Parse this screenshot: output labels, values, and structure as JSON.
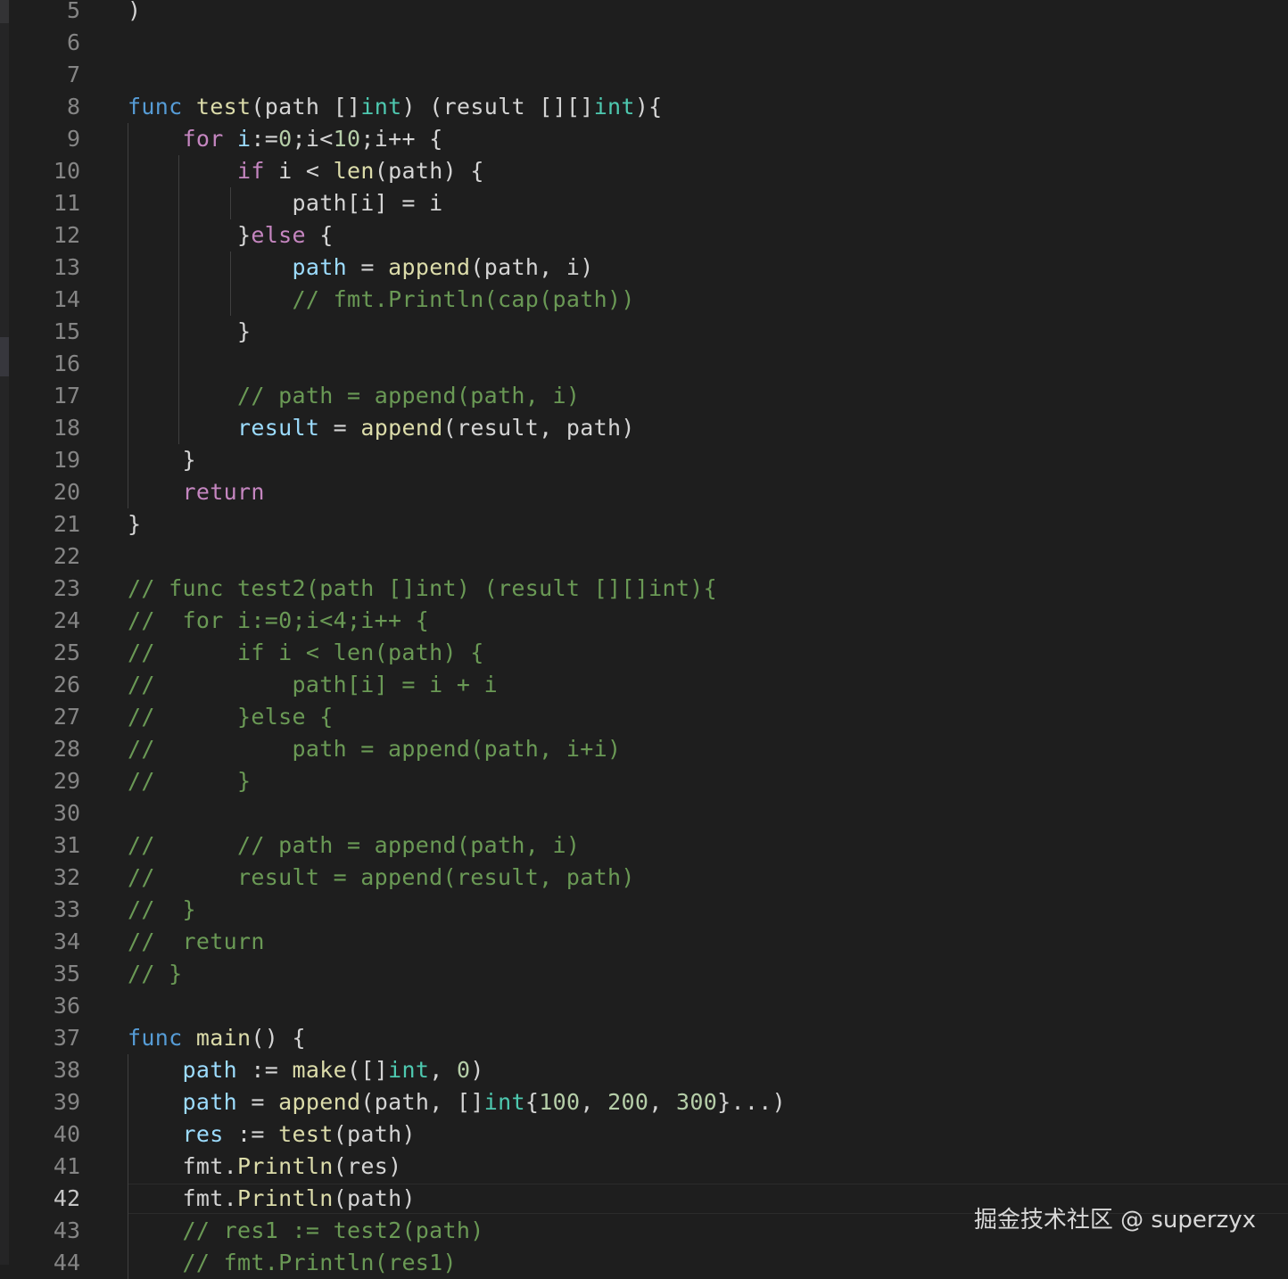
{
  "editor": {
    "current_line": 42,
    "lines": [
      {
        "n": "5",
        "tokens": [
          {
            "t": ")",
            "c": "txt"
          }
        ]
      },
      {
        "n": "6",
        "tokens": []
      },
      {
        "n": "7",
        "tokens": []
      },
      {
        "n": "8",
        "tokens": [
          {
            "t": "func",
            "c": "kw"
          },
          {
            "t": " ",
            "c": "txt"
          },
          {
            "t": "test",
            "c": "fn"
          },
          {
            "t": "(path []",
            "c": "txt"
          },
          {
            "t": "int",
            "c": "type"
          },
          {
            "t": ") (result [][]",
            "c": "txt"
          },
          {
            "t": "int",
            "c": "type"
          },
          {
            "t": "){",
            "c": "txt"
          }
        ]
      },
      {
        "n": "9",
        "tokens": [
          {
            "t": "    ",
            "c": "txt"
          },
          {
            "t": "for",
            "c": "ctl"
          },
          {
            "t": " ",
            "c": "txt"
          },
          {
            "t": "i",
            "c": "var"
          },
          {
            "t": ":=",
            "c": "txt"
          },
          {
            "t": "0",
            "c": "num"
          },
          {
            "t": ";i<",
            "c": "txt"
          },
          {
            "t": "10",
            "c": "num"
          },
          {
            "t": ";i++ {",
            "c": "txt"
          }
        ]
      },
      {
        "n": "10",
        "tokens": [
          {
            "t": "        ",
            "c": "txt"
          },
          {
            "t": "if",
            "c": "ctl"
          },
          {
            "t": " i < ",
            "c": "txt"
          },
          {
            "t": "len",
            "c": "fn"
          },
          {
            "t": "(path) {",
            "c": "txt"
          }
        ]
      },
      {
        "n": "11",
        "tokens": [
          {
            "t": "            path[i] = i",
            "c": "txt"
          }
        ]
      },
      {
        "n": "12",
        "tokens": [
          {
            "t": "        }",
            "c": "txt"
          },
          {
            "t": "else",
            "c": "ctl"
          },
          {
            "t": " {",
            "c": "txt"
          }
        ]
      },
      {
        "n": "13",
        "tokens": [
          {
            "t": "            ",
            "c": "txt"
          },
          {
            "t": "path",
            "c": "var"
          },
          {
            "t": " = ",
            "c": "txt"
          },
          {
            "t": "append",
            "c": "fn"
          },
          {
            "t": "(path, i)",
            "c": "txt"
          }
        ]
      },
      {
        "n": "14",
        "tokens": [
          {
            "t": "            ",
            "c": "txt"
          },
          {
            "t": "// fmt.Println(cap(path))",
            "c": "com"
          }
        ]
      },
      {
        "n": "15",
        "tokens": [
          {
            "t": "        }",
            "c": "txt"
          }
        ]
      },
      {
        "n": "16",
        "tokens": []
      },
      {
        "n": "17",
        "tokens": [
          {
            "t": "        ",
            "c": "txt"
          },
          {
            "t": "// path = append(path, i)",
            "c": "com"
          }
        ]
      },
      {
        "n": "18",
        "tokens": [
          {
            "t": "        ",
            "c": "txt"
          },
          {
            "t": "result",
            "c": "var"
          },
          {
            "t": " = ",
            "c": "txt"
          },
          {
            "t": "append",
            "c": "fn"
          },
          {
            "t": "(result, path)",
            "c": "txt"
          }
        ]
      },
      {
        "n": "19",
        "tokens": [
          {
            "t": "    }",
            "c": "txt"
          }
        ]
      },
      {
        "n": "20",
        "tokens": [
          {
            "t": "    ",
            "c": "txt"
          },
          {
            "t": "return",
            "c": "ctl"
          }
        ]
      },
      {
        "n": "21",
        "tokens": [
          {
            "t": "}",
            "c": "txt"
          }
        ]
      },
      {
        "n": "22",
        "tokens": []
      },
      {
        "n": "23",
        "tokens": [
          {
            "t": "// func test2(path []int) (result [][]int){",
            "c": "com"
          }
        ]
      },
      {
        "n": "24",
        "tokens": [
          {
            "t": "//  for i:=0;i<4;i++ {",
            "c": "com"
          }
        ]
      },
      {
        "n": "25",
        "tokens": [
          {
            "t": "//      if i < len(path) {",
            "c": "com"
          }
        ]
      },
      {
        "n": "26",
        "tokens": [
          {
            "t": "//          path[i] = i + i",
            "c": "com"
          }
        ]
      },
      {
        "n": "27",
        "tokens": [
          {
            "t": "//      }else {",
            "c": "com"
          }
        ]
      },
      {
        "n": "28",
        "tokens": [
          {
            "t": "//          path = append(path, i+i)",
            "c": "com"
          }
        ]
      },
      {
        "n": "29",
        "tokens": [
          {
            "t": "//      }",
            "c": "com"
          }
        ]
      },
      {
        "n": "30",
        "tokens": []
      },
      {
        "n": "31",
        "tokens": [
          {
            "t": "//      // path = append(path, i)",
            "c": "com"
          }
        ]
      },
      {
        "n": "32",
        "tokens": [
          {
            "t": "//      result = append(result, path)",
            "c": "com"
          }
        ]
      },
      {
        "n": "33",
        "tokens": [
          {
            "t": "//  }",
            "c": "com"
          }
        ]
      },
      {
        "n": "34",
        "tokens": [
          {
            "t": "//  return",
            "c": "com"
          }
        ]
      },
      {
        "n": "35",
        "tokens": [
          {
            "t": "// }",
            "c": "com"
          }
        ]
      },
      {
        "n": "36",
        "tokens": []
      },
      {
        "n": "37",
        "tokens": [
          {
            "t": "func",
            "c": "kw"
          },
          {
            "t": " ",
            "c": "txt"
          },
          {
            "t": "main",
            "c": "fn"
          },
          {
            "t": "() {",
            "c": "txt"
          }
        ]
      },
      {
        "n": "38",
        "tokens": [
          {
            "t": "    ",
            "c": "txt"
          },
          {
            "t": "path",
            "c": "var"
          },
          {
            "t": " := ",
            "c": "txt"
          },
          {
            "t": "make",
            "c": "fn"
          },
          {
            "t": "([]",
            "c": "txt"
          },
          {
            "t": "int",
            "c": "type"
          },
          {
            "t": ", ",
            "c": "txt"
          },
          {
            "t": "0",
            "c": "num"
          },
          {
            "t": ")",
            "c": "txt"
          }
        ]
      },
      {
        "n": "39",
        "tokens": [
          {
            "t": "    ",
            "c": "txt"
          },
          {
            "t": "path",
            "c": "var"
          },
          {
            "t": " = ",
            "c": "txt"
          },
          {
            "t": "append",
            "c": "fn"
          },
          {
            "t": "(path, []",
            "c": "txt"
          },
          {
            "t": "int",
            "c": "type"
          },
          {
            "t": "{",
            "c": "txt"
          },
          {
            "t": "100",
            "c": "num"
          },
          {
            "t": ", ",
            "c": "txt"
          },
          {
            "t": "200",
            "c": "num"
          },
          {
            "t": ", ",
            "c": "txt"
          },
          {
            "t": "300",
            "c": "num"
          },
          {
            "t": "}...)",
            "c": "txt"
          }
        ]
      },
      {
        "n": "40",
        "tokens": [
          {
            "t": "    ",
            "c": "txt"
          },
          {
            "t": "res",
            "c": "var"
          },
          {
            "t": " := ",
            "c": "txt"
          },
          {
            "t": "test",
            "c": "fn"
          },
          {
            "t": "(path)",
            "c": "txt"
          }
        ]
      },
      {
        "n": "41",
        "tokens": [
          {
            "t": "    fmt.",
            "c": "txt"
          },
          {
            "t": "Println",
            "c": "fn"
          },
          {
            "t": "(res)",
            "c": "txt"
          }
        ]
      },
      {
        "n": "42",
        "tokens": [
          {
            "t": "    fmt.",
            "c": "txt"
          },
          {
            "t": "Println",
            "c": "fn"
          },
          {
            "t": "(path)",
            "c": "txt"
          }
        ]
      },
      {
        "n": "43",
        "tokens": [
          {
            "t": "    ",
            "c": "txt"
          },
          {
            "t": "// res1 := test2(path)",
            "c": "com"
          }
        ]
      },
      {
        "n": "44",
        "tokens": [
          {
            "t": "    ",
            "c": "txt"
          },
          {
            "t": "// fmt.Println(res1)",
            "c": "com"
          }
        ]
      }
    ]
  },
  "watermark": "掘金技术社区 @ superzyx",
  "colors": {
    "background": "#1e1e1e",
    "keyword": "#569cd6",
    "control": "#c586c0",
    "function": "#dcdcaa",
    "variable": "#9cdcfe",
    "type": "#4ec9b0",
    "number": "#b5cea8",
    "comment": "#6a9955",
    "text": "#d4d4d4",
    "line_number": "#858585"
  }
}
